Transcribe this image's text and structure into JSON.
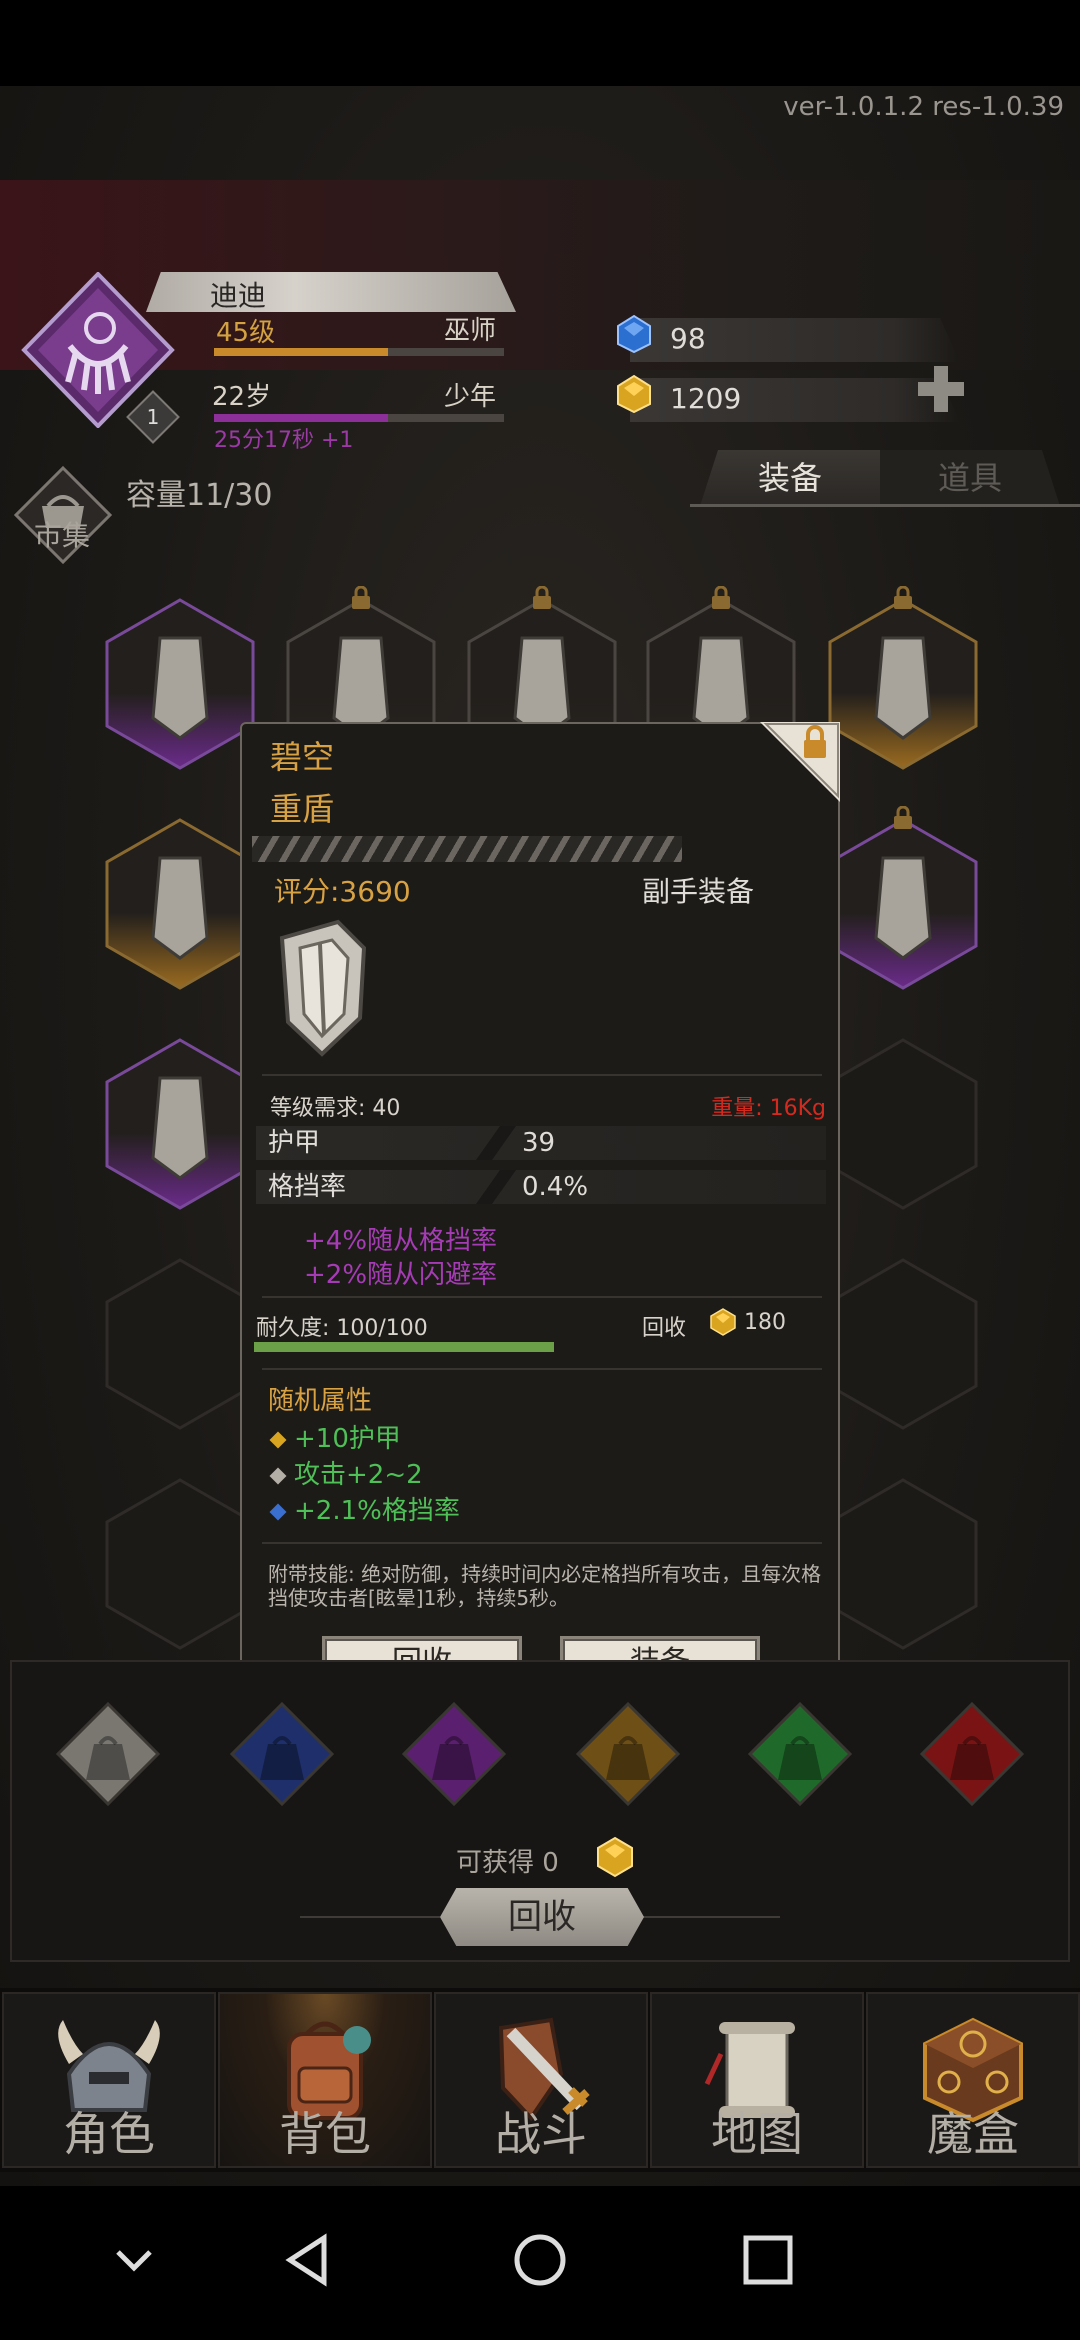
{
  "version": "ver-1.0.1.2  res-1.0.39",
  "player": {
    "name": "迪迪",
    "level": "45级",
    "class": "巫师",
    "age": "22岁",
    "stage": "少年",
    "timer": "25分17秒 +1",
    "badge": "1",
    "level_progress": 0.6,
    "age_progress": 0.6
  },
  "currency": {
    "blue_gem": "98",
    "gold": "1209"
  },
  "inventory": {
    "market_label": "市集",
    "capacity": "容量11/30",
    "tabs": [
      "装备",
      "道具"
    ]
  },
  "popup": {
    "name": "碧空",
    "type": "重盾",
    "score": "评分:3690",
    "slot": "副手装备",
    "level_req": "等级需求: 40",
    "weight": "重量: 16Kg",
    "stats": [
      {
        "key": "护甲",
        "value": "39"
      },
      {
        "key": "格挡率",
        "value": "0.4%"
      }
    ],
    "bonuses": [
      "+4%随从格挡率",
      "+2%随从闪避率"
    ],
    "durability": "耐久度: 100/100",
    "durability_progress": 1.0,
    "recycle_label": "回收",
    "recycle_value": "180",
    "random_title": "随机属性",
    "random": [
      "+10护甲",
      "攻击+2~2",
      "+2.1%格挡率"
    ],
    "skill": "附带技能: 绝对防御，持续时间内必定格挡所有攻击，且每次格挡使攻击者[眩晕]1秒，持续5秒。",
    "btn_recycle": "回收",
    "btn_equip": "装备"
  },
  "bottom": {
    "earn": "可获得 0",
    "recycle": "回收"
  },
  "nav": [
    "角色",
    "背包",
    "战斗",
    "地图",
    "魔盒"
  ],
  "colors": {
    "gold_text": "#d8a243",
    "purple": "#9b3aa5",
    "green": "#4fbf57",
    "red": "#d32a20"
  }
}
